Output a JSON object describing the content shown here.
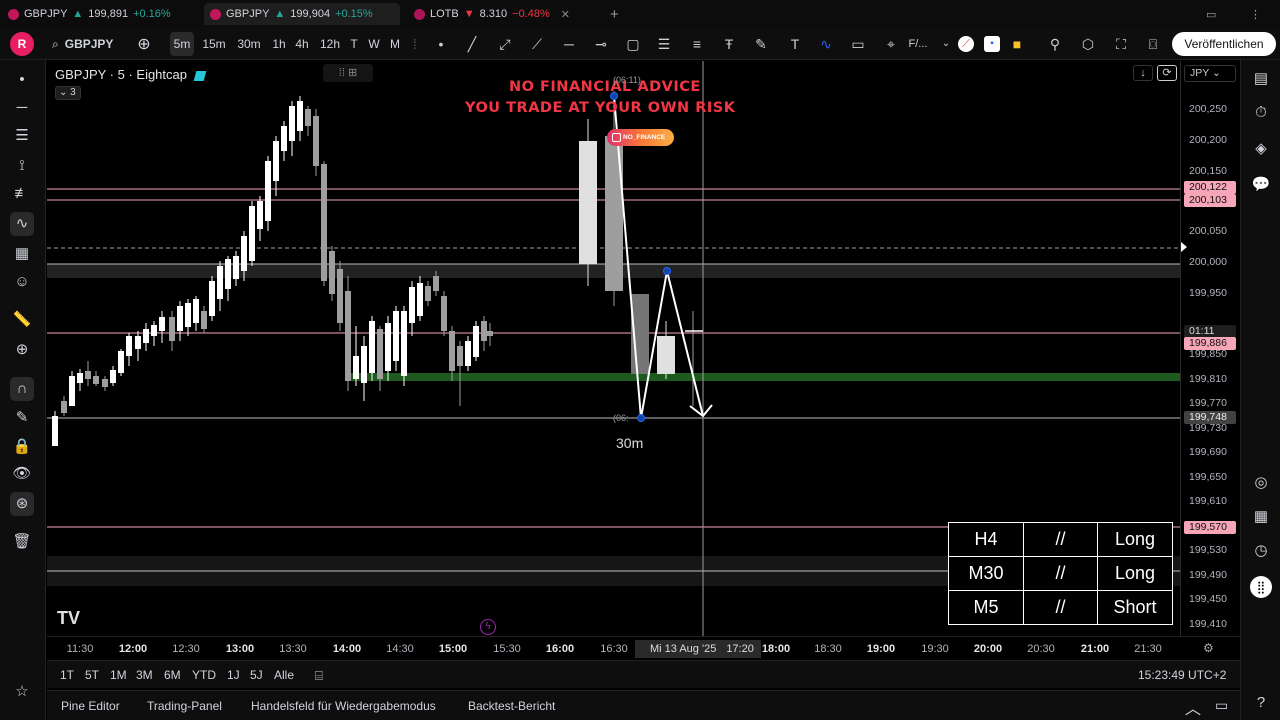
{
  "tabs": [
    {
      "symbol": "GBPJPY",
      "arrow": "▲",
      "price": "199,891",
      "change": "+0.16%",
      "direction": "up"
    },
    {
      "symbol": "GBPJPY",
      "arrow": "▲",
      "price": "199,904",
      "change": "+0.15%",
      "direction": "up"
    },
    {
      "symbol": "LOTB",
      "arrow": "▼",
      "price": "8.310",
      "change": "−0.48%",
      "direction": "down"
    }
  ],
  "toolbar": {
    "avatar": "R",
    "symbol": "GBPJPY",
    "intervals": [
      "5m",
      "15m",
      "30m",
      "1h",
      "4h",
      "12h",
      "T",
      "W",
      "M"
    ],
    "selected_interval": "5m",
    "template_label": "F/...",
    "publish_label": "Veröffentlichen"
  },
  "chart": {
    "title": "GBPJPY · 5 · Eightcap",
    "collapse_count": "3",
    "warning_line1": "NO FINANCIAL ADVICE",
    "warning_line2": "YOU TRADE AT YOUR OWN RISK",
    "badge": "NO_FINANCE",
    "timer_top": "(06:11)",
    "timer_bottom": "(06:",
    "timeframe_label": "30m",
    "bias_table": [
      [
        "H4",
        "//",
        "Long"
      ],
      [
        "M30",
        "//",
        "Long"
      ],
      [
        "M5",
        "//",
        "Short"
      ]
    ]
  },
  "price_axis": {
    "currency": "JPY",
    "ticks": [
      "200,250",
      "200,200",
      "200,150",
      "200,050",
      "200,000",
      "199,950",
      "199,850",
      "199,810",
      "199,770",
      "199,730",
      "199,690",
      "199,650",
      "199,610",
      "199,530",
      "199,490",
      "199,450",
      "199,410"
    ],
    "labels": [
      {
        "text": "200,122",
        "type": "pink"
      },
      {
        "text": "200,103",
        "type": "pink"
      },
      {
        "text": "01:11",
        "type": "dark"
      },
      {
        "text": "199,886",
        "type": "pink"
      },
      {
        "text": "199,748",
        "type": "grey"
      },
      {
        "text": "199,570",
        "type": "pink"
      }
    ]
  },
  "time_axis": {
    "ticks": [
      "11:30",
      "12:00",
      "12:30",
      "13:00",
      "13:30",
      "14:00",
      "14:30",
      "15:00",
      "15:30",
      "16:00",
      "16:30",
      "18:00",
      "18:30",
      "19:00",
      "19:30",
      "20:00",
      "20:30",
      "21:00",
      "21:30"
    ],
    "bold_ticks": [
      "12:00",
      "13:00",
      "14:00",
      "15:00",
      "16:00",
      "18:00",
      "19:00",
      "20:00",
      "21:00"
    ],
    "cursor_label": "Mi 13 Aug '25",
    "cursor_time": "17:20"
  },
  "ranges": [
    "1T",
    "5T",
    "1M",
    "3M",
    "6M",
    "YTD",
    "1J",
    "5J",
    "Alle"
  ],
  "clock": "15:23:49 UTC+2",
  "panels": [
    "Pine Editor",
    "Trading-Panel",
    "Handelsfeld für Wiedergabemodus",
    "Backtest-Bericht"
  ],
  "colors": {
    "up": "#26a69a",
    "down": "#f23645",
    "accent": "#2962ff",
    "zone": "#1e5a1e",
    "pink_line": "#f7a6b8"
  }
}
